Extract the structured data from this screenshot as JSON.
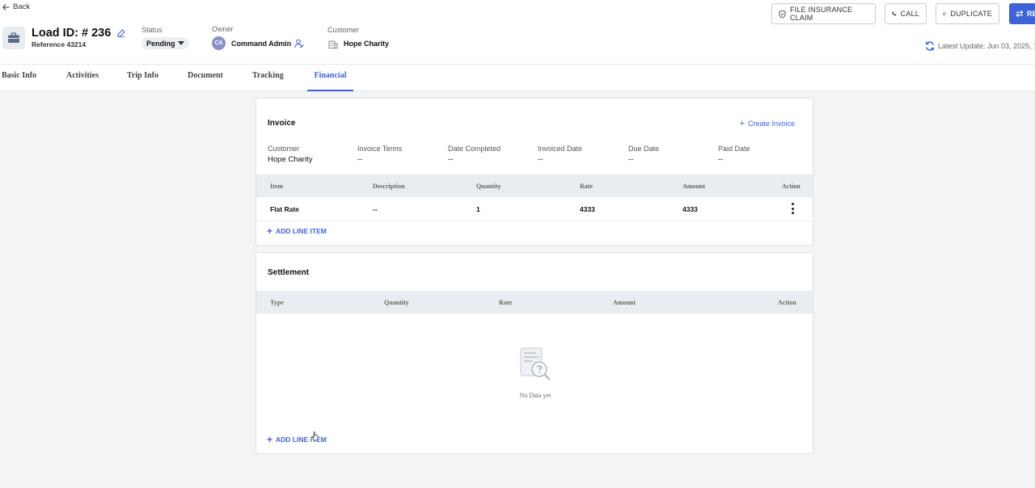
{
  "header": {
    "back_label": "Back",
    "load_title": "Load ID: # 236",
    "reference": "Reference 43214",
    "status_label": "Status",
    "status_value": "Pending",
    "owner_label": "Owner",
    "owner_initials": "CA",
    "owner_name": "Command Admin",
    "customer_label": "Customer",
    "customer_name": "Hope Charity",
    "buttons": {
      "insurance": "FILE INSURANCE CLAIM",
      "call": "CALL",
      "duplicate": "DUPLICATE",
      "primary": "RE"
    },
    "latest_update": "Latest Update: Jun 03, 2025, 1"
  },
  "tabs": [
    {
      "label": "Basic Info",
      "active": false
    },
    {
      "label": "Activities",
      "active": false
    },
    {
      "label": "Trip Info",
      "active": false
    },
    {
      "label": "Document",
      "active": false
    },
    {
      "label": "Tracking",
      "active": false
    },
    {
      "label": "Financial",
      "active": true
    }
  ],
  "invoice": {
    "title": "Invoice",
    "create_label": "Create Invoice",
    "info": [
      {
        "label": "Customer",
        "value": "Hope Charity"
      },
      {
        "label": "Invoice Terms",
        "value": "--"
      },
      {
        "label": "Date Completed",
        "value": "--"
      },
      {
        "label": "Invoiced Date",
        "value": "--"
      },
      {
        "label": "Due Date",
        "value": "--"
      },
      {
        "label": "Paid Date",
        "value": "--"
      }
    ],
    "columns": [
      "Item",
      "Description",
      "Quantity",
      "Rate",
      "Amount",
      "Action"
    ],
    "rows": [
      {
        "item": "Flat Rate",
        "description": "--",
        "quantity": "1",
        "rate": "4333",
        "amount": "4333"
      }
    ],
    "add_line_label": "ADD LINE ITEM"
  },
  "settlement": {
    "title": "Settlement",
    "columns": [
      "Type",
      "Quantity",
      "Rate",
      "Amount",
      "Action"
    ],
    "empty_text": "No Data yet",
    "add_line_label": "ADD LINE ITEM"
  },
  "colors": {
    "accent": "#3e63d9",
    "avatar": "#8c92c9",
    "table_header": "#e9ecf1"
  }
}
